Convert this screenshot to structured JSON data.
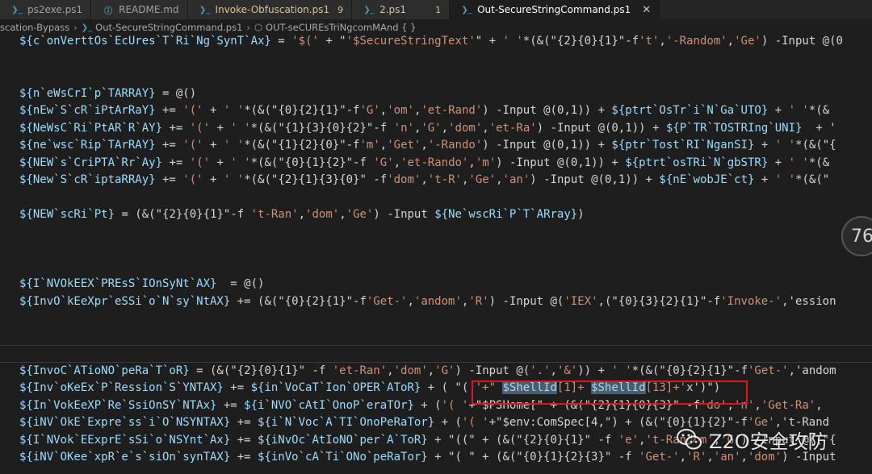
{
  "tabs": [
    {
      "label": "ps2exe.ps1",
      "icon": "powershell-icon",
      "active": false
    },
    {
      "label": "README.md",
      "icon": "info-icon",
      "active": false
    },
    {
      "label": "Invoke-Obfuscation.ps1",
      "badge": "9",
      "icon": "powershell-icon",
      "active": false,
      "warn": true
    },
    {
      "label": "2.ps1",
      "badge": "1",
      "icon": "powershell-icon",
      "active": false,
      "warn": true
    },
    {
      "label": "Out-SecureStringCommand.ps1",
      "icon": "powershell-icon",
      "active": true
    }
  ],
  "breadcrumb": {
    "folder": "scation-Bypass",
    "file": "Out-SecureStringCommand.ps1",
    "symbol": "OUT-seCUREsTriNgcomMAnd { }"
  },
  "code_lines": [
    "${c`onVerttOs`EcUres`T`Ri`Ng`SynT`Ax} = '$(' + \"'$SecureStringText'\" + ' '*(&(\"{2}{0}{1}\"-f't','-Random','Ge') -Input @(0",
    "",
    "",
    "${n`eWsCrI`p`TARRAY} = @()",
    "${nEw`S`cR`iPtArRaY} += '(' + ' '*(&(\"{0}{2}{1}\"-f'G','om','et-Rand') -Input @(0,1)) + ${ptrt`OsTr`i`N`Ga`UTO} + ' '*(&",
    "${NeWsC`Ri`PtAR`R`AY} += '(' + ' '*(&(\"{1}{3}{0}{2}\"-f 'n','G','dom','et-Ra') -Input @(0,1)) + ${P`TR`TOSTRIng`UNI}  + '",
    "${ne`wsc`Rip`TArRAY} += '(' + ' '*(&(\"{1}{2}{0}\"-f'm','Get','-Rando') -Input @(0,1)) + ${ptr`Tost`RI`NganSI} + ' '*(&(\"{",
    "${NEW`s`CriPTA`Rr`Ay} += '(' + ' '*(&(\"{0}{1}{2}\"-f 'G','et-Rando','m') -Input @(0,1)) + ${ptrt`osTRi`N`gbSTR} + ' '*(&",
    "${New`S`cR`iptaRRAy} += '(' + ' '*(&(\"{2}{1}{3}{0}\" -f'dom','t-R','Ge','an') -Input @(0,1)) + ${nE`wobJE`ct} + ' '*(&(\"",
    "",
    "${NEW`scRi`Pt} = (&(\"{2}{0}{1}\"-f 't-Ran','dom','Ge') -Input ${Ne`wscRi`P`T`ARray})",
    "",
    "",
    "",
    "${I`NVOkEEX`PREsS`IOnSyNt`AX}  = @()",
    "${InvO`kEeXpr`eSSi`o`N`sy`NtAX} += (&(\"{0}{2}{1}\"-f'Get-','andom','R') -Input @('IEX',(\"{0}{3}{2}{1}\"-f'Invoke-','ession",
    "",
    "",
    "",
    "${InvoC`ATioNO`peRa`T`oR} = (&(\"{2}{0}{1}\" -f 'et-Ran','dom','G') -Input @('.','&')) + ' '*(&(\"{0}{2}{1}\"-f'Get-','andom",
    "${Inv`oKeEx`P`Ression`S`YNTAX} += ${in`VoCaT`Ion`OPER`AToR} + ( \"( '+\" $ShellId[1]+ $ShellId[13]+'x')\")",
    "${In`VokEeXP`Re`SsiOnSY`NTAx} += ${i`NVO`cAtI`OnoP`eraTOr} + ('( '+\"$PSHome[\" + (&(\"{2}{1}{0}{3}\" -f'do','n','Get-Ra',",
    "${iNV`OkE`Expre`ss`i`O`NSYNTAX} += ${i`N`Voc`A`TI`OnoPeRaTor} + ('( '+\"$env:ComSpec[4,\") + (&(\"{0}{1}{2}\"-f'Ge','t-Rand",
    "${I`NVok`EExprE`sSi`o`NSYnt`Ax} += ${iNvOc`AtIoNO`per`A`ToR} + \"((\" + (&(\"{2}{0}{1}\" -f 'e','t-Random','G') -Input @((\"{",
    "${iNV`OKee`xpR`e`s`siOn`synTAX} += ${inVo`cA`Ti`ONo`peRaTor} + \"( \" + (&(\"{0}{1}{2}{3}\" -f 'Get-','R','an','dom') -Input"
  ],
  "score_badge": "76",
  "watermark": "Z2O安全攻防",
  "colors": {
    "highlight_box": "#e0141e",
    "selection": "#515c6a",
    "variable": "#9cdcfe",
    "string": "#ce9178",
    "number": "#b5cea8"
  }
}
